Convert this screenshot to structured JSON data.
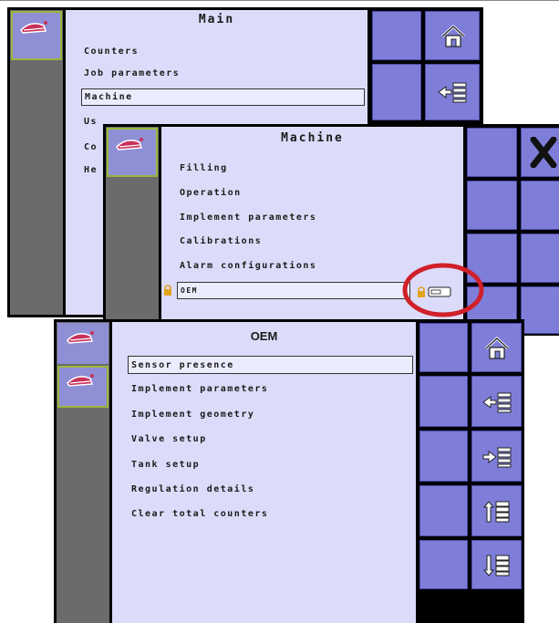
{
  "main": {
    "title": "Main",
    "items": [
      "Counters",
      "Job parameters",
      "Machine",
      "Us",
      "Co",
      "He"
    ],
    "selected_index": 2,
    "buttons": [
      "home-icon",
      "back-list-icon"
    ]
  },
  "machine": {
    "title": "Machine",
    "items": [
      "Filling",
      "Operation",
      "Implement parameters",
      "Calibrations",
      "Alarm configurations",
      "OEM"
    ],
    "selected_index": 5,
    "locked_item": "OEM",
    "buttons": [
      "close-icon"
    ]
  },
  "oem": {
    "title": "OEM",
    "items": [
      "Sensor presence",
      "Implement parameters",
      "Implement geometry",
      "Valve setup",
      "Tank setup",
      "Regulation details",
      "Clear total counters"
    ],
    "selected_index": 0,
    "buttons": [
      "home-icon",
      "back-list-icon",
      "enter-list-icon",
      "scroll-up-icon",
      "scroll-down-icon"
    ]
  },
  "colors": {
    "background_content": "#dcdcfa",
    "button_fill": "#7e7ed9",
    "icon_tile": "#8f8fd6",
    "selected_tile_border": "#9bb63a",
    "left_column": "#6b6b6b",
    "highlight_ring": "#d0202a",
    "lock_color": "#e2a21a"
  }
}
